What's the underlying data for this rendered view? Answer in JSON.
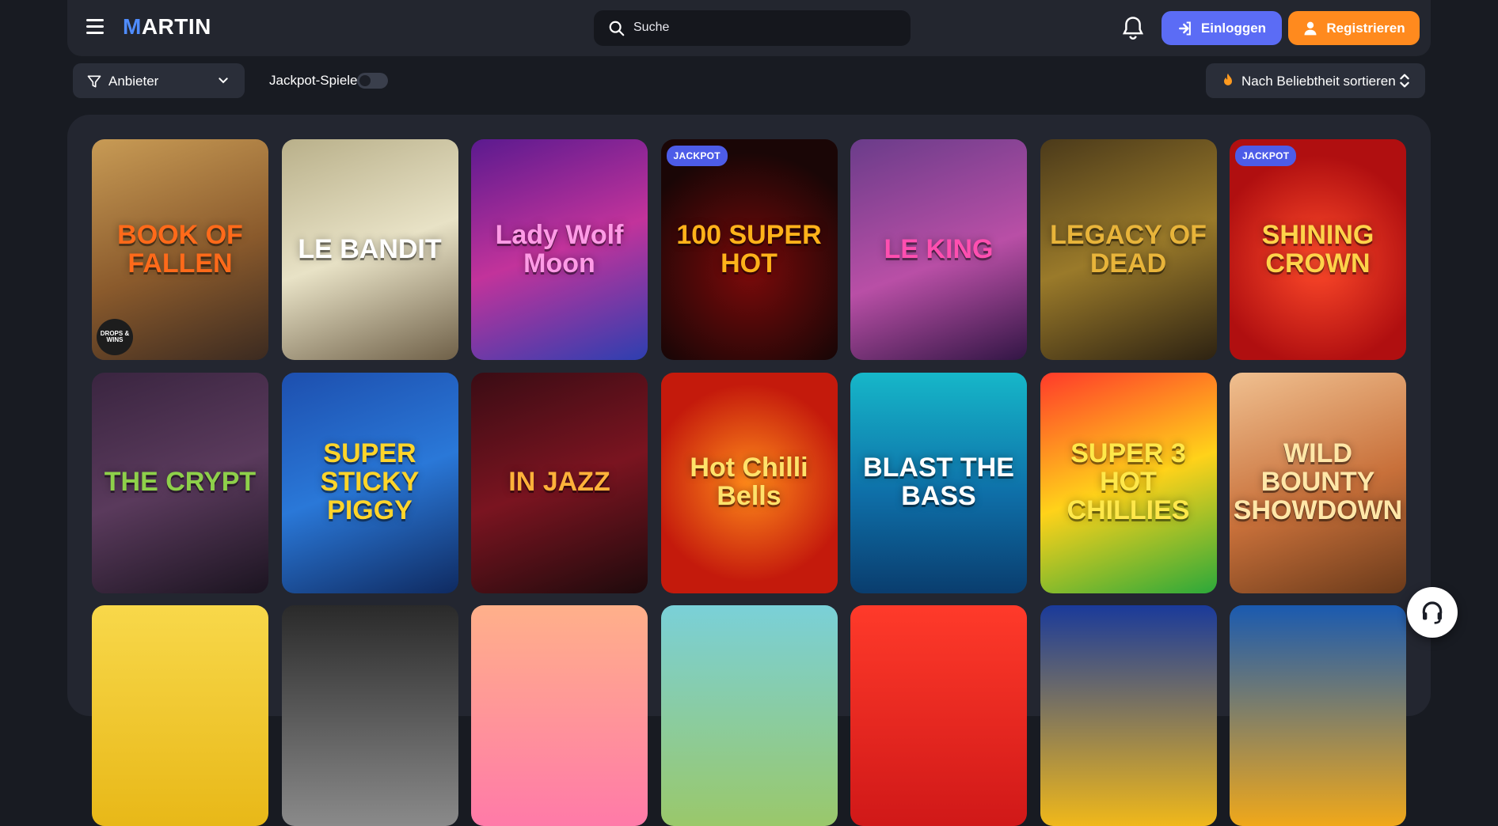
{
  "header": {
    "logo": "MARTIN",
    "search_placeholder": "Suche",
    "login_label": "Einloggen",
    "register_label": "Registrieren"
  },
  "filters": {
    "provider_label": "Anbieter",
    "jackpot_label": "Jackpot-Spiele",
    "jackpot_enabled": false,
    "sort_label": "Nach Beliebtheit sortieren"
  },
  "colors": {
    "accent_blue": "#5b6cf5",
    "accent_orange": "#ff8a1e",
    "background": "#181b22",
    "panel": "#232630"
  },
  "games": [
    {
      "title": "BOOK OF FALLEN",
      "badge": "",
      "drops": "DROPS & WINS"
    },
    {
      "title": "LE BANDIT",
      "badge": "",
      "drops": ""
    },
    {
      "title": "Lady Wolf Moon",
      "badge": "",
      "drops": ""
    },
    {
      "title": "100 SUPER HOT",
      "badge": "JACKPOT",
      "drops": ""
    },
    {
      "title": "LE KING",
      "badge": "",
      "drops": ""
    },
    {
      "title": "LEGACY OF DEAD",
      "badge": "",
      "drops": ""
    },
    {
      "title": "SHINING CROWN",
      "badge": "JACKPOT",
      "drops": ""
    },
    {
      "title": "THE CRYPT",
      "badge": "",
      "drops": ""
    },
    {
      "title": "SUPER STICKY PIGGY",
      "badge": "",
      "drops": ""
    },
    {
      "title": "IN JAZZ",
      "badge": "",
      "drops": ""
    },
    {
      "title": "Hot Chilli Bells",
      "badge": "",
      "drops": ""
    },
    {
      "title": "BLAST THE BASS",
      "badge": "",
      "drops": ""
    },
    {
      "title": "SUPER 3 HOT CHILLIES",
      "badge": "",
      "drops": ""
    },
    {
      "title": "WILD BOUNTY SHOWDOWN",
      "badge": "",
      "drops": ""
    },
    {
      "title": "",
      "badge": "",
      "drops": ""
    },
    {
      "title": "",
      "badge": "",
      "drops": ""
    },
    {
      "title": "",
      "badge": "",
      "drops": ""
    },
    {
      "title": "",
      "badge": "",
      "drops": ""
    },
    {
      "title": "",
      "badge": "",
      "drops": ""
    },
    {
      "title": "",
      "badge": "",
      "drops": ""
    },
    {
      "title": "",
      "badge": "",
      "drops": ""
    }
  ]
}
